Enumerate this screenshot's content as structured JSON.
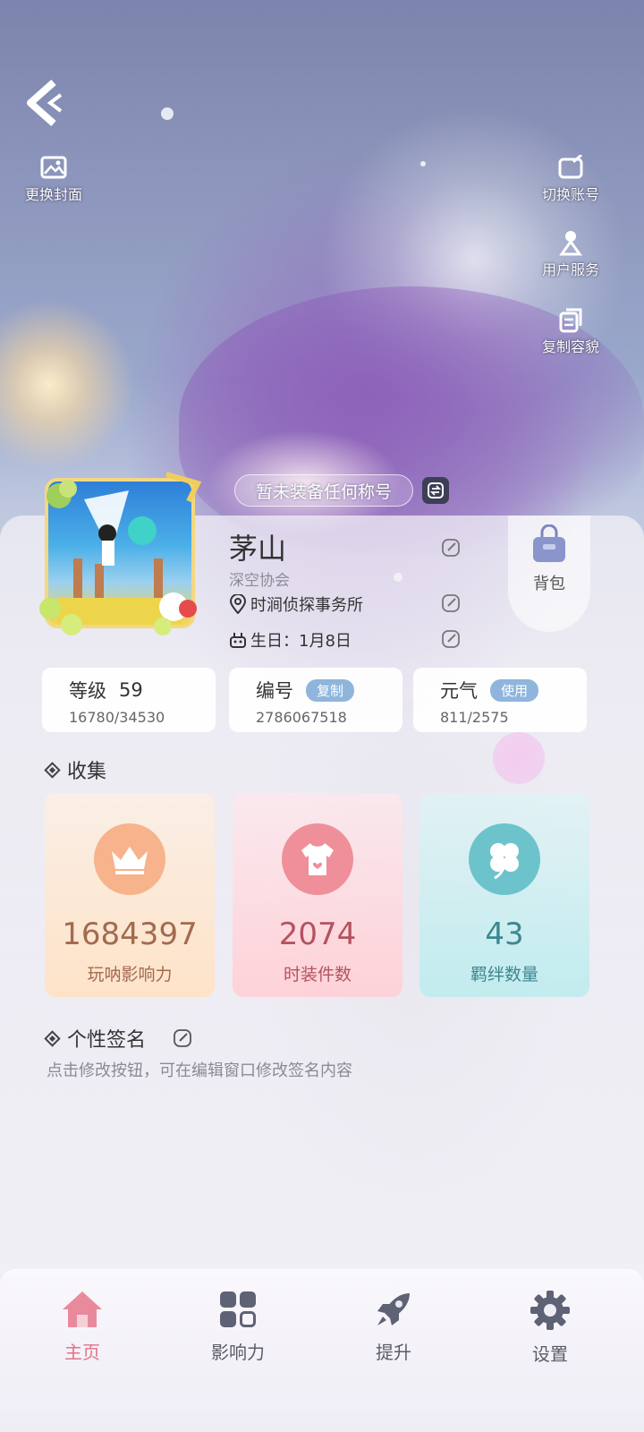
{
  "header": {
    "cover_label": "更换封面",
    "switch_account_label": "切换账号",
    "user_service_label": "用户服务",
    "copy_appearance_label": "复制容貌",
    "title_placeholder": "暂未装备任何称号"
  },
  "profile": {
    "name": "茅山",
    "guild": "深空协会",
    "office": "时涧侦探事务所",
    "birthday": "生日：1月8日",
    "bag_label": "背包"
  },
  "stats": {
    "level_label": "等级",
    "level_value": "59",
    "level_progress": "16780/34530",
    "id_label": "编号",
    "id_copy_label": "复制",
    "id_value": "2786067518",
    "energy_label": "元气",
    "energy_use_label": "使用",
    "energy_value": "811/2575"
  },
  "collection": {
    "heading": "收集",
    "cards": [
      {
        "value": "1684397",
        "label": "玩呐影响力",
        "icon": "crown-icon",
        "color": "#f6b38c"
      },
      {
        "value": "2074",
        "label": "时装件数",
        "icon": "tshirt-icon",
        "color": "#ef8f99"
      },
      {
        "value": "43",
        "label": "羁绊数量",
        "icon": "clover-icon",
        "color": "#6cc3cb"
      }
    ]
  },
  "signature": {
    "heading": "个性签名",
    "text": "点击修改按钮，可在编辑窗口修改签名内容"
  },
  "nav": {
    "items": [
      {
        "label": "主页",
        "icon": "home-icon",
        "active": true,
        "color": "#e1748a"
      },
      {
        "label": "影响力",
        "icon": "grid-icon",
        "active": false
      },
      {
        "label": "提升",
        "icon": "rocket-icon",
        "active": false
      },
      {
        "label": "设置",
        "icon": "gear-icon",
        "active": false
      }
    ]
  }
}
